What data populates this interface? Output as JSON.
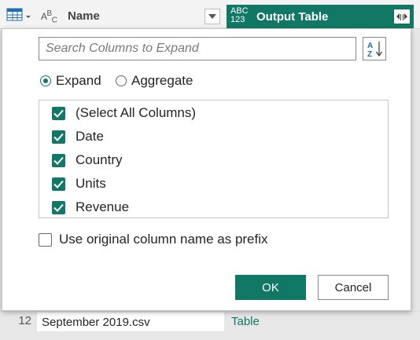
{
  "grid": {
    "columns": [
      {
        "type_icon": "abc-text-icon",
        "type_label": "A",
        "type_sub": "B",
        "type_sub2": "C",
        "name": "Name"
      },
      {
        "type_icon": "abc123-any-icon",
        "type_line1": "ABC",
        "type_line2": "123",
        "name": "Output Table"
      }
    ],
    "rows": [
      {
        "number": "12",
        "name": "September 2019.csv",
        "output": "Table"
      }
    ]
  },
  "popup": {
    "search": {
      "placeholder": "Search Columns to Expand",
      "value": ""
    },
    "modes": [
      {
        "label": "Expand",
        "selected": true
      },
      {
        "label": "Aggregate",
        "selected": false
      }
    ],
    "columns": [
      {
        "label": "(Select All Columns)",
        "checked": true
      },
      {
        "label": "Date",
        "checked": true
      },
      {
        "label": "Country",
        "checked": true
      },
      {
        "label": "Units",
        "checked": true
      },
      {
        "label": "Revenue",
        "checked": true
      }
    ],
    "prefix": {
      "label": "Use original column name as prefix",
      "checked": false
    },
    "ok_label": "OK",
    "cancel_label": "Cancel"
  },
  "colors": {
    "accent": "#117865",
    "border": "#8a8886"
  }
}
